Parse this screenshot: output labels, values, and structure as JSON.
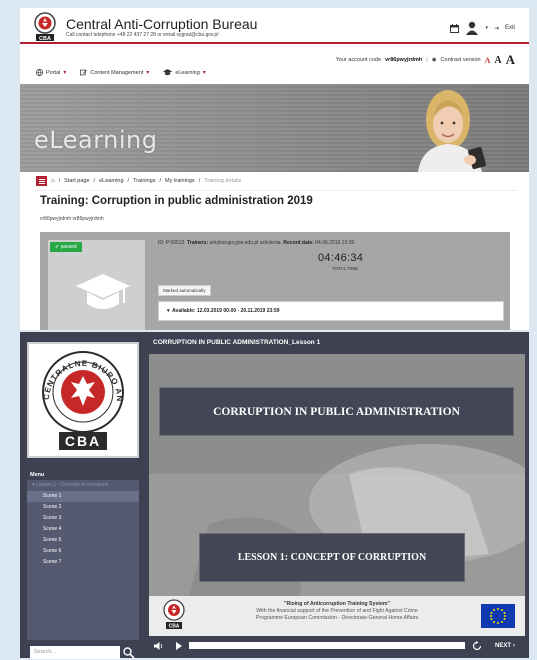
{
  "portal": {
    "brand_name": "Central Anti-Corruption Bureau",
    "brand_contact": "Call contact telephone +48 22 437 27 28 or email sygnal@cba.gov.pl",
    "logo_text": "CBA",
    "logout_label": "Exit",
    "account_prefix": "Your account code",
    "account_code": "vr86pwyjrdmh",
    "contrast_label": "Contrast version",
    "font_sizes": [
      "A",
      "A",
      "A"
    ],
    "nav": [
      {
        "label": "Portal",
        "icon": "globe-icon"
      },
      {
        "label": "Content Management",
        "icon": "edit-icon"
      },
      {
        "label": "eLearning",
        "icon": "graduation-cap-icon"
      }
    ],
    "hero_title": "eLearning",
    "breadcrumb": [
      "Start page",
      "eLearning",
      "Trainings",
      "My trainings",
      "Training details"
    ],
    "training": {
      "title": "Training: Corruption in public administration 2019",
      "user": "vr86pwyjrdmh vr86pwyjrdmh",
      "status": "passed",
      "id_label": "ID:",
      "id_value": "P 00513",
      "trainers_label": "Trainers:",
      "trainers_value": "antykorupcyjne.edu.pl szkolenia",
      "record_label": "Record date:",
      "record_value": "04.06.2019 13:39",
      "total_time": "04:46:34",
      "total_time_label": "TOTAL TIME",
      "marked_label": "Marked automatically",
      "available": "Available: 12.03.2019 00:00 - 20.11.2019 23:59"
    }
  },
  "player": {
    "title": "CORRUPTION IN PUBLIC ADMINISTRATION_Lesson 1",
    "logo_text": "CBA",
    "logo_ring_text": "CENTRALNE BIURO ANTYKORUPCYJNE",
    "menu_label": "Menu",
    "lesson_item": "Lesson 1 - Concept of corruption",
    "scenes": [
      "Scene 1",
      "Scene 2",
      "Scene 3",
      "Scene 4",
      "Scene 5",
      "Scene 6",
      "Scene 7"
    ],
    "active_scene": "Scene 1",
    "search_placeholder": "Search...",
    "slide_title": "CORRUPTION IN PUBLIC ADMINISTRATION",
    "slide_lesson": "LESSON 1: CONCEPT OF CORRUPTION",
    "footer_line1": "\"Rising of Anticorruption Training System\"",
    "footer_line2": "With the financial support of the Prevention of and Fight Against Crime",
    "footer_line3": "Programme European Commission - Directorate-General Home Affairs",
    "next_label": "NEXT",
    "progress": 0.0
  },
  "colors": {
    "brand_red": "#b32033",
    "passed_green": "#27a844",
    "player_bg": "#3e4152",
    "menu_bg": "#565a71",
    "eu_blue": "#103bb0"
  }
}
